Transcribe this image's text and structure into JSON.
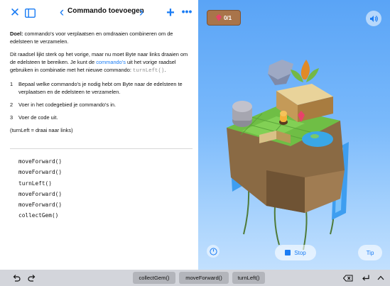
{
  "header": {
    "title": "Commando toevoegen",
    "close_icon": "close-icon",
    "sidebar_icon": "sidebar-icon",
    "prev_icon": "chevron-left-icon",
    "next_icon": "chevron-right-icon",
    "add_icon": "plus-icon",
    "more_icon": "more-icon"
  },
  "instructions": {
    "goal_label": "Doel:",
    "goal_text": " commando's voor verplaatsen en omdraaien combineren om de edelsteen te verzamelen.",
    "intro_part1": "Dit raadsel lijkt sterk op het vorige, maar nu moet Byte naar links draaien om de edelsteen te bereiken. Je kunt de ",
    "intro_link": "commando's",
    "intro_part2": " uit het vorige raadsel gebruiken in combinatie met het nieuwe commando: ",
    "intro_code": "turnLeft()",
    "intro_end": ".",
    "steps": [
      {
        "num": "1",
        "text": "Bepaal welke commando's je nodig hebt om Byte naar de edelsteen te verplaatsen en de edelsteen te verzamelen."
      },
      {
        "num": "2",
        "text": "Voer in het codegebied je commando's in."
      },
      {
        "num": "3",
        "text": "Voer de code uit."
      }
    ],
    "note": "(turnLeft = draai naar links)"
  },
  "code_lines": [
    "moveForward()",
    "moveForward()",
    "turnLeft()",
    "moveForward()",
    "moveForward()",
    "collectGem()"
  ],
  "scene": {
    "gem_counter": "0/1",
    "gem_icon": "gem-icon",
    "sound_icon": "speaker-icon",
    "speed_icon": "speed-meter-icon",
    "stop_label": "Stop",
    "stop_icon": "stop-icon",
    "tip_label": "Tip"
  },
  "shortcut_bar": {
    "undo_icon": "undo-icon",
    "redo_icon": "redo-icon",
    "suggestions": [
      "collectGem()",
      "moveForward()",
      "turnLeft()"
    ],
    "delete_icon": "delete-backward-icon",
    "return_icon": "return-icon",
    "hide_keyboard_icon": "chevron-up-icon"
  },
  "colors": {
    "accent": "#1a7cf4",
    "sky_top": "#5aa4f6",
    "sky_bottom": "#c2e0fe",
    "bar_background": "#d3d5db"
  }
}
